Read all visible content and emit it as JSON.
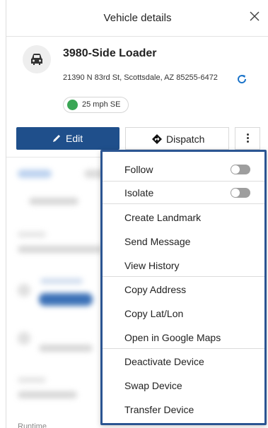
{
  "header": {
    "title": "Vehicle details",
    "close_icon": "close-icon"
  },
  "vehicle": {
    "name": "3980-Side Loader",
    "address": "21390 N 83rd St, Scottsdale, AZ 85255-6472",
    "speed": "25 mph SE",
    "status_color": "#3aa655",
    "avatar_icon": "car-icon"
  },
  "actions": {
    "edit_label": "Edit",
    "dispatch_label": "Dispatch"
  },
  "menu": {
    "follow": "Follow",
    "isolate": "Isolate",
    "create_landmark": "Create Landmark",
    "send_message": "Send Message",
    "view_history": "View History",
    "copy_address": "Copy Address",
    "copy_latlon": "Copy Lat/Lon",
    "open_google_maps": "Open in Google Maps",
    "deactivate_device": "Deactivate Device",
    "swap_device": "Swap Device",
    "transfer_device": "Transfer Device",
    "follow_on": false,
    "isolate_on": false
  },
  "background": {
    "runtime_label": "Runtime"
  },
  "colors": {
    "primary": "#1f4f8b",
    "menu_border": "#2b5592",
    "refresh": "#1a73c9"
  }
}
